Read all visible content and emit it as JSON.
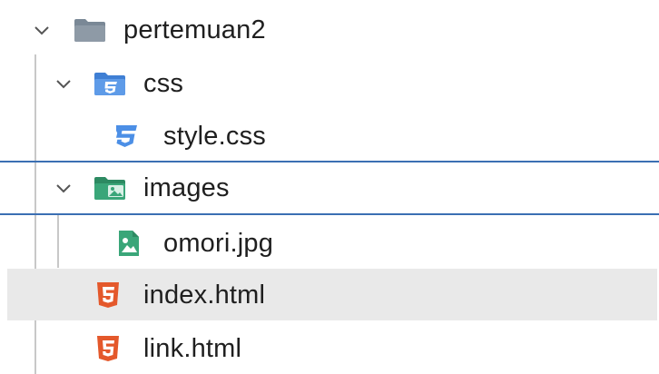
{
  "explorer": {
    "items": [
      {
        "label": "pertemuan2",
        "kind": "folder",
        "icon": "folder-icon",
        "expanded": true
      },
      {
        "label": "css",
        "kind": "folder",
        "icon": "css-folder-icon",
        "expanded": true
      },
      {
        "label": "style.css",
        "kind": "file",
        "icon": "css3-file-icon"
      },
      {
        "label": "images",
        "kind": "folder",
        "icon": "images-folder-icon",
        "expanded": true
      },
      {
        "label": "omori.jpg",
        "kind": "file",
        "icon": "image-file-icon"
      },
      {
        "label": "index.html",
        "kind": "file",
        "icon": "html5-file-icon"
      },
      {
        "label": "link.html",
        "kind": "file",
        "icon": "html5-file-icon"
      }
    ]
  },
  "colors": {
    "focus_outline": "#3b6fb3",
    "hover_background": "#e9e9e9",
    "html_icon": "#e4582b",
    "css_icon": "#4c8fe6",
    "images_folder": "#3aa679"
  }
}
